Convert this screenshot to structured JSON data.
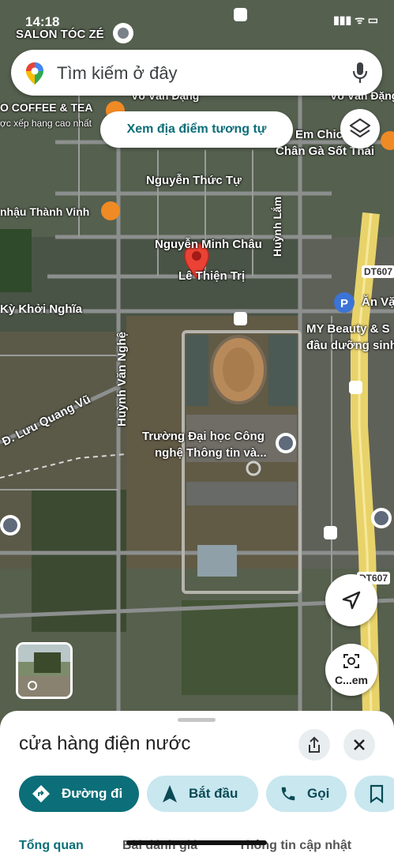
{
  "status": {
    "time": "14:18",
    "signal_text": "▮▮▮ ᯤ ▭"
  },
  "search": {
    "placeholder": "Tìm kiếm ở đây"
  },
  "similar_button": "Xem địa điểm tương tự",
  "map_labels": {
    "salon": "SALON TÓC ZÉ",
    "coffee": "O COFFEE & TEA",
    "coffee_sub": "ợc xếp hạng cao nhất",
    "vo_van_dang_1": "Võ Văn Đặng",
    "vo_van_dang_2": "Võ Văn Đặng",
    "em_chic": "Em Chic",
    "chan_ga": "Chân Gà Sốt Thái",
    "nguyen_thuc_tu": "Nguyễn Thức Tự",
    "nhau_thanh_vinh": "nhậu Thành Vinh",
    "nguyen_minh_chau": "Nguyễn Minh Châu",
    "le_thien_tri": "Lê Thiện Trị",
    "huynh_lam": "Huỳnh Lắm",
    "dt607_1": "DT607",
    "dt607_2": "DT607",
    "ky_khoi_nghia": "Kỳ Khởi Nghĩa",
    "an_va": "Ăn Vặ",
    "my_beauty": "MY Beauty & S",
    "dau_duong": "đầu dưỡng sinh",
    "huynh_van_nghe": "Huỳnh Văn Nghệ",
    "luu_quang_vu": "Đ. Lưu Quang Vũ",
    "truong_1": "Trường Đại học Công",
    "truong_2": "nghệ Thông tin và..."
  },
  "camera_button": "C...em",
  "place": {
    "title": "cửa hàng điện nước",
    "actions": [
      {
        "label": "Đường đi"
      },
      {
        "label": "Bắt đầu"
      },
      {
        "label": "Gọi"
      }
    ],
    "tabs": [
      "Tổng quan",
      "Bài đánh giá",
      "Thông tin cập nhật"
    ]
  },
  "colors": {
    "teal": "#0b6e78",
    "pin_red": "#ea4335",
    "light_teal": "#c8e7ef"
  }
}
